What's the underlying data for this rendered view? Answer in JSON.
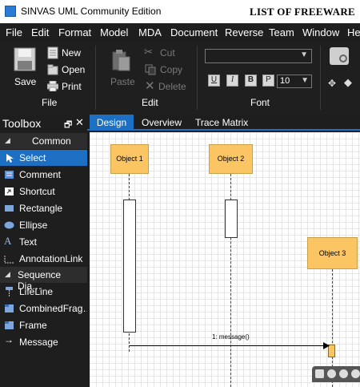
{
  "titlebar": {
    "app_title": "SINVAS UML Community Edition",
    "watermark": "LIST OF FREEWARE"
  },
  "menu": [
    "File",
    "Edit",
    "Format",
    "Model",
    "MDA",
    "Document",
    "Reverse",
    "Team",
    "Window",
    "He"
  ],
  "ribbon": {
    "file_group": {
      "label": "File",
      "save": "Save",
      "new": "New",
      "open": "Open",
      "print": "Print"
    },
    "edit_group": {
      "label": "Edit",
      "paste": "Paste",
      "cut": "Cut",
      "copy": "Copy",
      "delete": "Delete"
    },
    "font_group": {
      "label": "Font",
      "font_size": "10",
      "style_buttons": [
        "U",
        "I",
        "B",
        "P"
      ]
    }
  },
  "toolbox": {
    "title": "Toolbox",
    "categories": [
      {
        "label": "Common",
        "items": [
          "Select",
          "Comment",
          "Shortcut",
          "Rectangle",
          "Ellipse",
          "Text",
          "AnnotationLink"
        ]
      },
      {
        "label": "Sequence Dia…",
        "items": [
          "LifeLine",
          "CombinedFrag…",
          "Frame",
          "Message"
        ]
      }
    ],
    "selected": "Select"
  },
  "tabs": [
    "Design",
    "Overview",
    "Trace Matrix"
  ],
  "diagram": {
    "objects": [
      "Object 1",
      "Object 2",
      "Object 3"
    ],
    "message": "1: message()"
  },
  "colors": {
    "accent": "#1c6fc2",
    "object_fill": "#fcc564"
  }
}
